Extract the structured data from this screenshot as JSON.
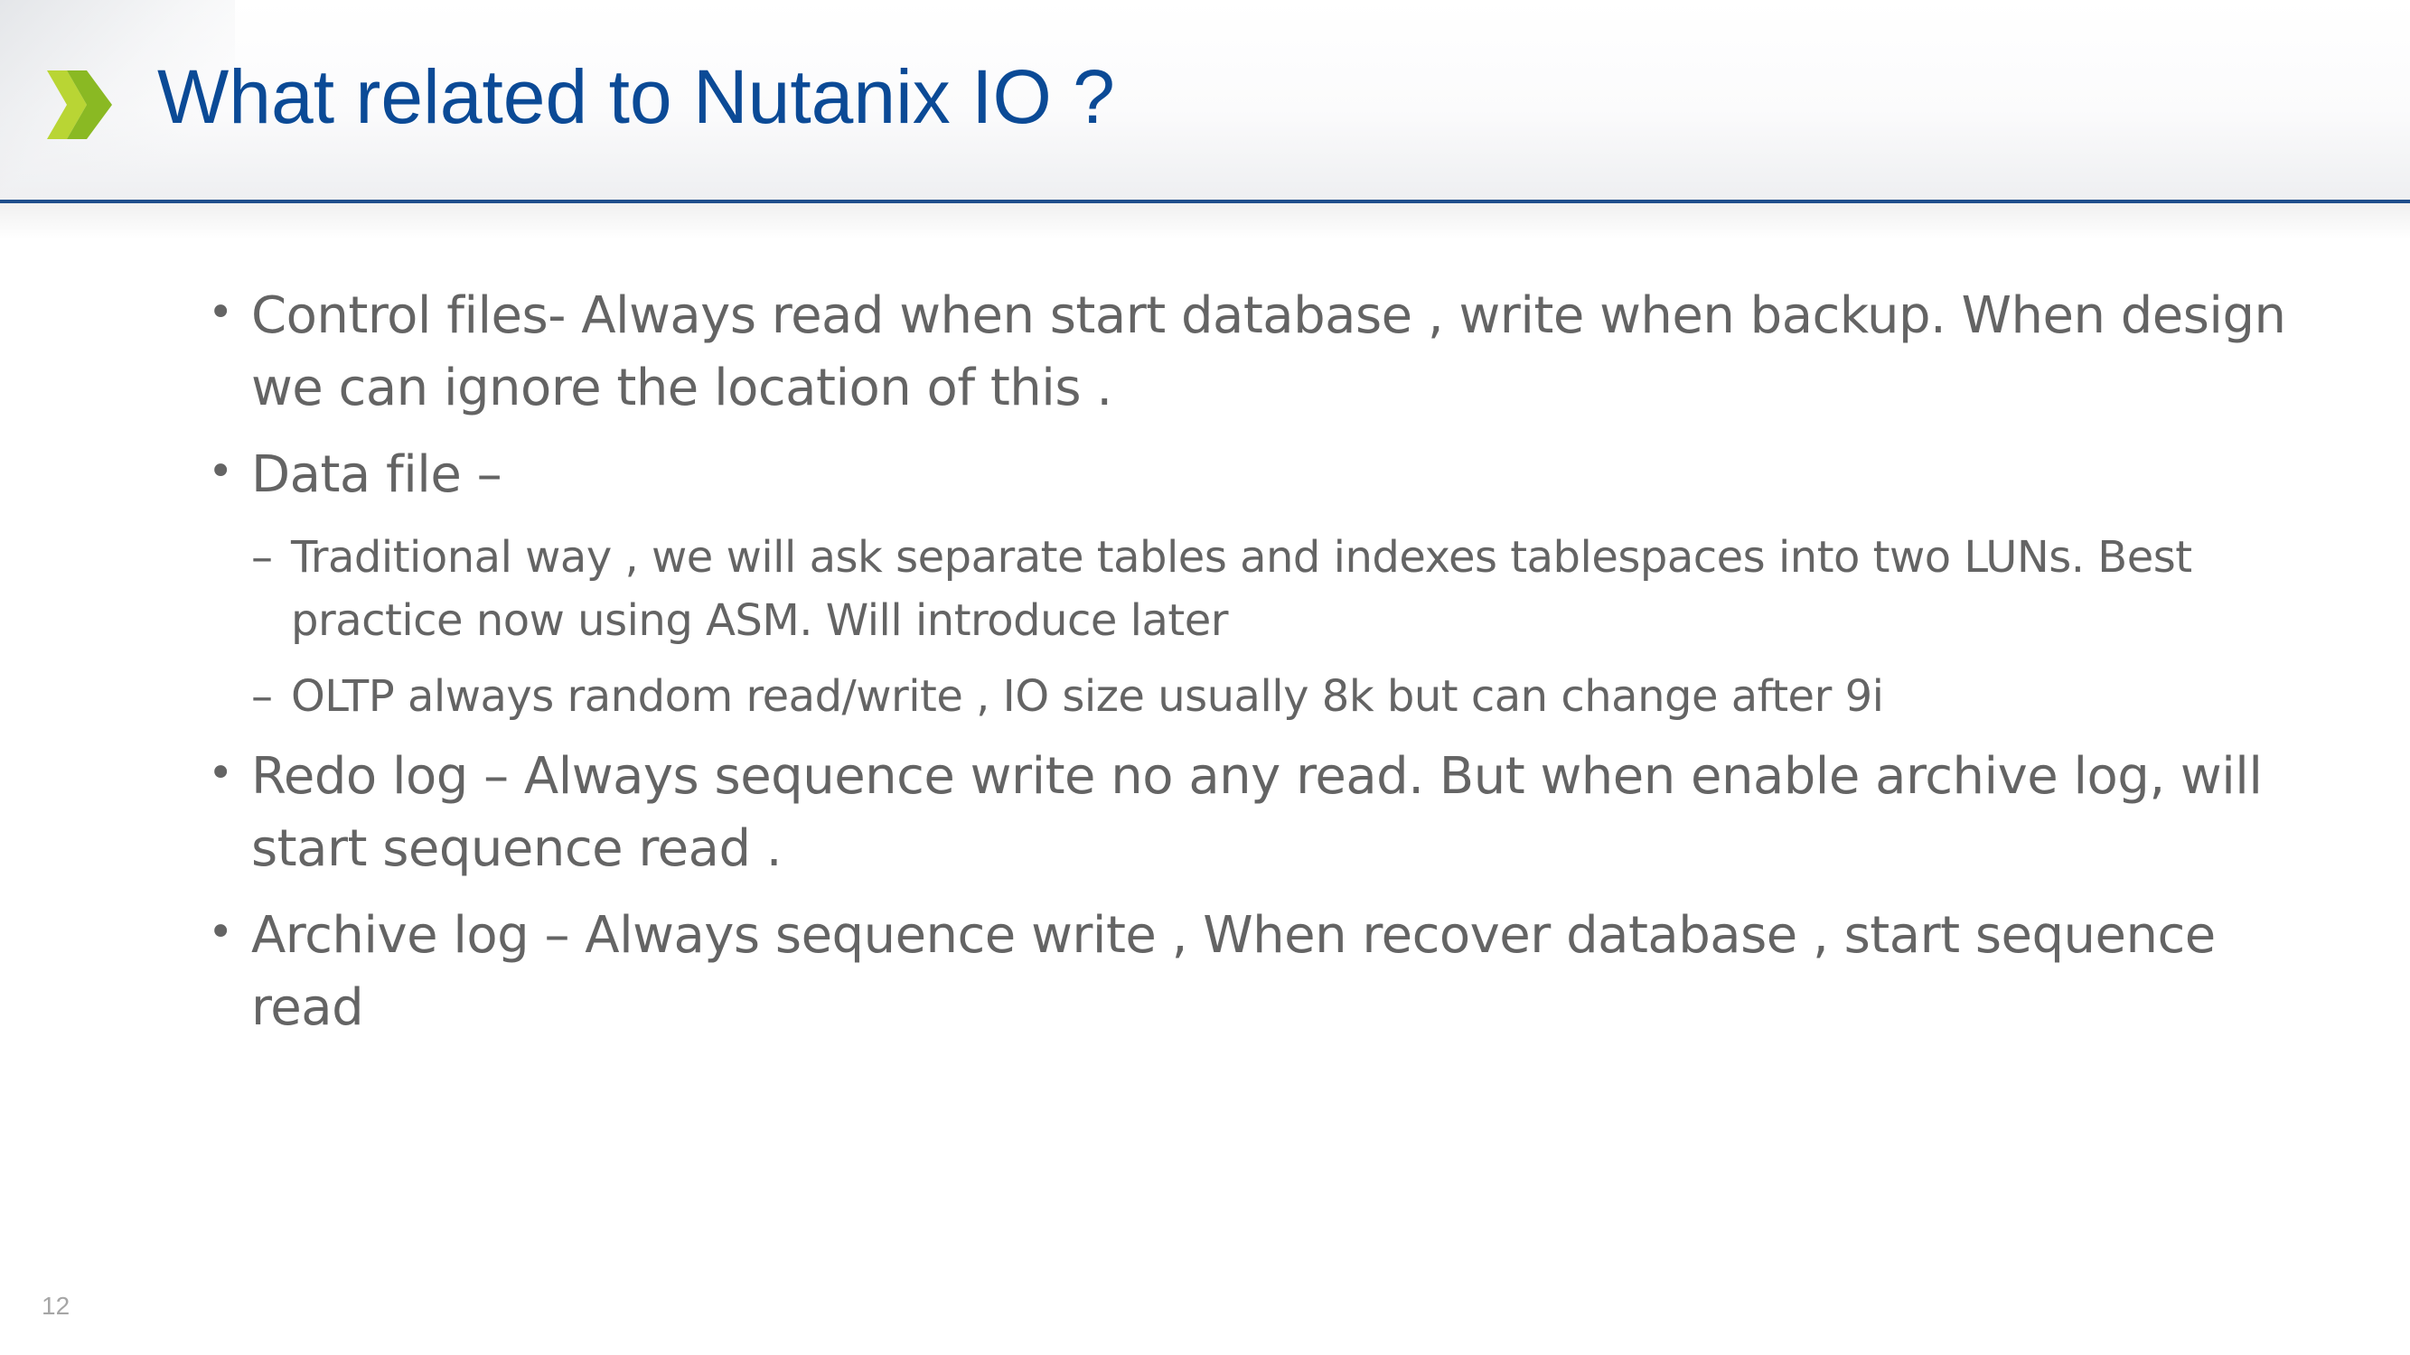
{
  "slide": {
    "title": "What related to Nutanix IO ?",
    "logo_icon": "chevron-right-icon",
    "brand_colors": {
      "title": "#0b4a96",
      "rule": "#1f4e8c",
      "chevron_light": "#b7d433",
      "chevron_dark": "#7fae1b",
      "body_text": "#646464"
    },
    "bullets": [
      {
        "marker": "•",
        "text": "Control files- Always read when start database , write when backup. When design we can ignore the location of this ."
      },
      {
        "marker": "•",
        "text": "Data file –"
      }
    ],
    "sub_bullets": [
      {
        "marker": "–",
        "text": "Traditional way , we will ask separate tables and indexes tablespaces into two LUNs. Best practice now using ASM. Will introduce later"
      },
      {
        "marker": "–",
        "text": "OLTP always random read/write , IO size usually 8k but can change after 9i"
      }
    ],
    "bullets_after": [
      {
        "marker": "•",
        "text": "Redo log – Always sequence write no any read. But when enable archive log, will start sequence read ."
      },
      {
        "marker": "•",
        "text": "Archive log – Always sequence write , When recover database , start sequence read"
      }
    ],
    "page_number": "12"
  }
}
